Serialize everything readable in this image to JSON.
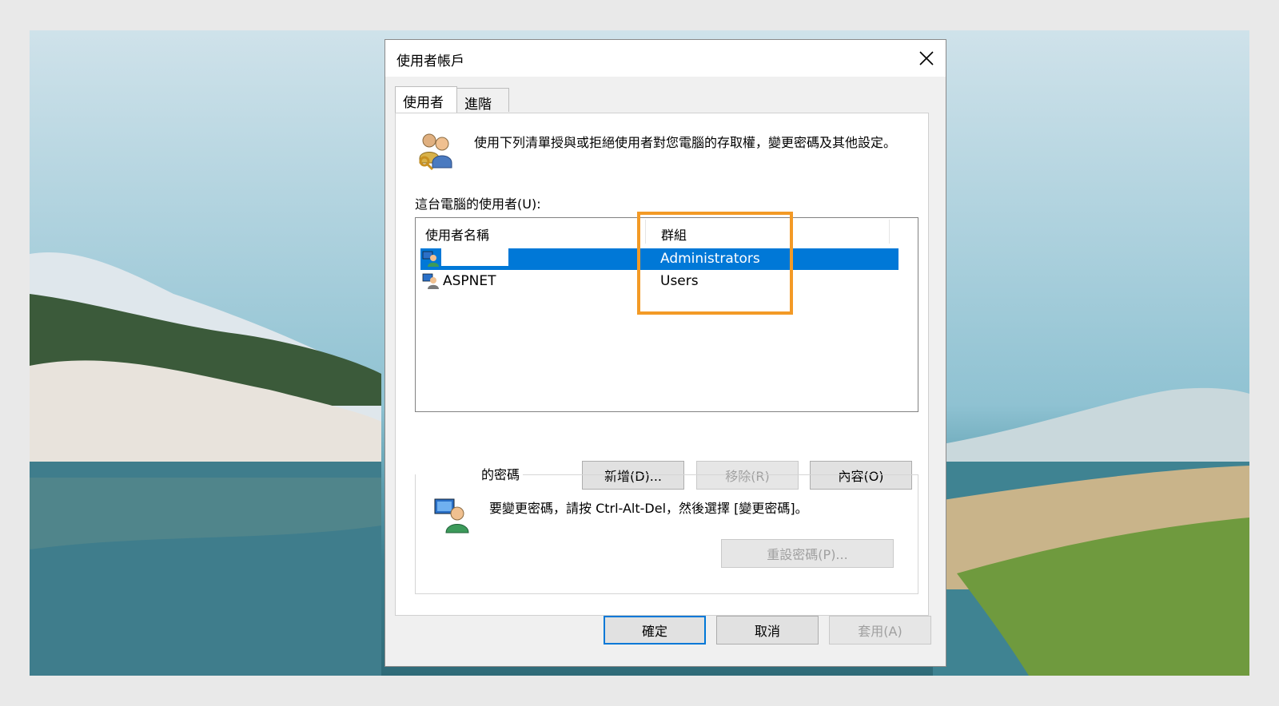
{
  "dialog": {
    "title": "使用者帳戶",
    "tabs": [
      {
        "label": "使用者",
        "active": true
      },
      {
        "label": "進階",
        "active": false
      }
    ],
    "description": "使用下列清單授與或拒絕使用者對您電腦的存取權，變更密碼及其他設定。",
    "users_label": "這台電腦的使用者(U):",
    "list": {
      "columns": [
        "使用者名稱",
        "群組"
      ],
      "rows": [
        {
          "name": "",
          "group": "Administrators",
          "selected": true
        },
        {
          "name": "ASPNET",
          "group": "Users",
          "selected": false
        }
      ]
    },
    "list_buttons": {
      "add": "新增(D)...",
      "remove": "移除(R)",
      "properties": "內容(O)"
    },
    "password_group": {
      "legend": "的密碼",
      "text": "要變更密碼，請按 Ctrl-Alt-Del，然後選擇 [變更密碼]。",
      "reset_button": "重設密碼(P)..."
    },
    "footer": {
      "ok": "確定",
      "cancel": "取消",
      "apply": "套用(A)"
    }
  },
  "colors": {
    "selection": "#0078d7",
    "highlight_annotation": "#f39a26",
    "dialog_bg": "#f0f0f0"
  },
  "icons": [
    "users-icon",
    "user-row-icon",
    "user-row-icon",
    "user-password-icon",
    "close-icon"
  ]
}
